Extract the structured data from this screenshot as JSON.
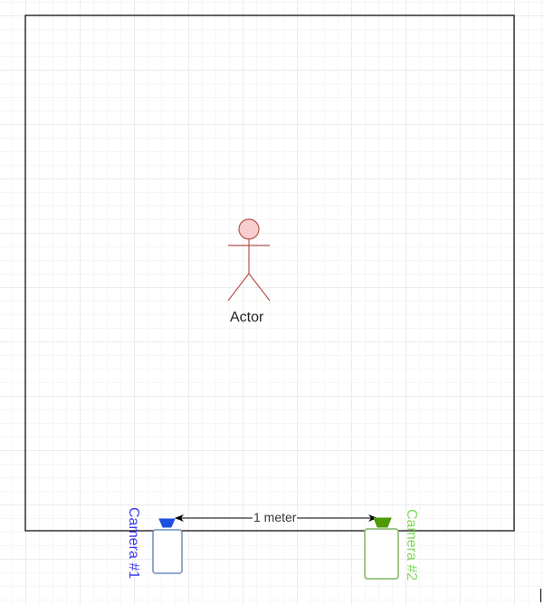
{
  "diagram": {
    "actor": {
      "label": "Actor",
      "icon": "stick-figure-icon",
      "color": "#b85450",
      "fill": "#f8cecc"
    },
    "distance": {
      "label": "1 meter"
    },
    "cameras": [
      {
        "label": "Camera #1",
        "icon": "camera-icon",
        "color": "#3b3bf0"
      },
      {
        "label": "Camera #2",
        "icon": "camera-icon",
        "color": "#7ed957"
      }
    ]
  }
}
